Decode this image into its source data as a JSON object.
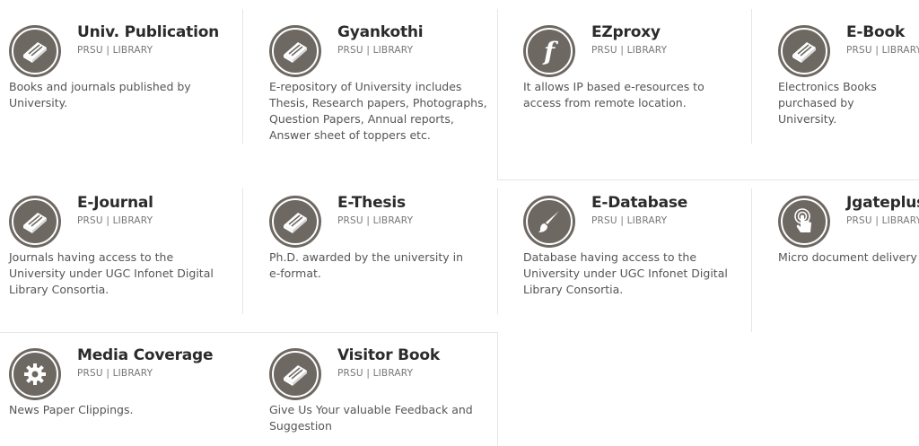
{
  "cards": [
    {
      "title": "Univ. Publication",
      "subtitle": "PRSU | LIBRARY",
      "description": "Books and journals published by University.",
      "icon": "book-icon"
    },
    {
      "title": "Gyankothi",
      "subtitle": "PRSU | LIBRARY",
      "description": "E-repository of University includes Thesis, Research papers, Photographs, Question Papers, Annual reports, Answer sheet of toppers etc.",
      "icon": "book-icon"
    },
    {
      "title": "EZproxy",
      "subtitle": "PRSU | LIBRARY",
      "description": "It allows IP based e-resources to access from remote location.",
      "icon": "function-icon"
    },
    {
      "title": "E-Book",
      "subtitle": "PRSU | LIBRARY",
      "description": "Electronics Books purchased by University.",
      "icon": "book-icon"
    },
    {
      "title": "E-Journal",
      "subtitle": "PRSU | LIBRARY",
      "description": "Journals having access to the University under UGC Infonet Digital Library Consortia.",
      "icon": "book-icon"
    },
    {
      "title": "E-Thesis",
      "subtitle": "PRSU | LIBRARY",
      "description": "Ph.D. awarded by the university in e-format.",
      "icon": "book-icon"
    },
    {
      "title": "E-Database",
      "subtitle": "PRSU | LIBRARY",
      "description": "Database having access to the University under UGC Infonet Digital Library Consortia.",
      "icon": "brush-icon"
    },
    {
      "title": "Jgateplus",
      "subtitle": "PRSU | LIBRARY",
      "description": "Micro document delivery",
      "icon": "touch-icon"
    },
    {
      "title": "Media Coverage",
      "subtitle": "PRSU | LIBRARY",
      "description": "News Paper Clippings.",
      "icon": "gear-icon"
    },
    {
      "title": "Visitor Book",
      "subtitle": "PRSU | LIBRARY",
      "description": "Give Us Your valuable Feedback and Suggestion",
      "icon": "book-icon"
    }
  ],
  "colors": {
    "icon_bg": "#6e6862",
    "title": "#2b2b2b",
    "text": "#555555",
    "divider": "#e6e6e6"
  }
}
